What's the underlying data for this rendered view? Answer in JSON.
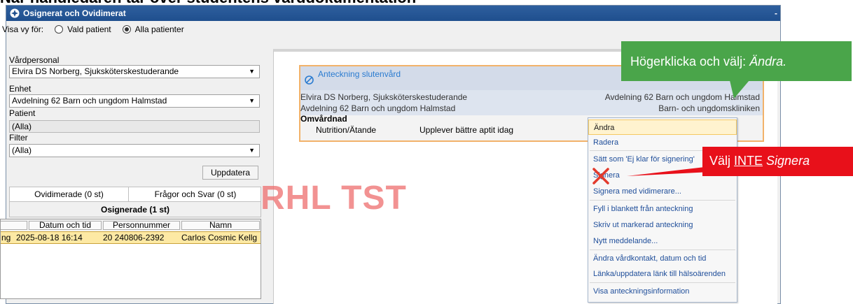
{
  "heading": "När handledaren tar över studentens vårddokumentation",
  "window": {
    "title": "Osignerat och Ovidimerat",
    "minimize": "-"
  },
  "view": {
    "label": "Visa vy för:",
    "option_selected": "Alla patienter",
    "option_other": "Vald patient"
  },
  "filters": {
    "staff_label": "Vårdpersonal",
    "staff_value": "Elvira DS Norberg, Sjuksköterskestuderande",
    "unit_label": "Enhet",
    "unit_value": "Avdelning 62 Barn och ungdom Halmstad",
    "patient_label": "Patient",
    "patient_value": "(Alla)",
    "filter_label": "Filter",
    "filter_value": "(Alla)",
    "update_button": "Uppdatera"
  },
  "tabs": {
    "unvidimated": "Ovidimerade  (0 st)",
    "questions": "Frågor och Svar  (0 st)",
    "unsigned": "Osignerade  (1 st)"
  },
  "grid": {
    "columns": [
      "Datum och tid",
      "Personnummer",
      "Namn"
    ],
    "row": {
      "prefix": "ng",
      "datetime": "2025-08-18 16:14",
      "pnr": "20 240806-2392",
      "name": "Carlos Cosmic Kellg"
    }
  },
  "watermark": "RHL TST",
  "note": {
    "title": "Anteckning slutenvård",
    "author": "Elvira DS Norberg, Sjuksköterskestuderande",
    "unit": "Avdelning 62 Barn och ungdom Halmstad",
    "right_unit": "Avdelning 62 Barn och ungdom Halmstad",
    "clinic": "Barn- och ungdomskliniken",
    "section": "Omvårdnad",
    "keyword": "Nutrition/Ätande",
    "text": "Upplever bättre aptit idag"
  },
  "callouts": {
    "green_prefix": "Högerklicka och välj: ",
    "green_emphasis": "Ändra.",
    "red_prefix": "Välj ",
    "red_underlined": "INTE",
    "red_suffix": " Signera"
  },
  "context_menu": [
    "Ändra",
    "Radera",
    "Sätt som 'Ej klar för signering'",
    "Signera",
    "Signera med vidimerare...",
    "Fyll i blankett från anteckning",
    "Skriv ut markerad anteckning",
    "Nytt meddelande...",
    "Ändra vårdkontakt, datum och tid",
    "Länka/uppdatera länk till hälsoärenden",
    "Visa anteckningsinformation"
  ],
  "colors": {
    "callout_green": "#4aa54a",
    "callout_red": "#e8101a",
    "selected_row": "#fde9a4",
    "note_border": "#f2b26a"
  }
}
